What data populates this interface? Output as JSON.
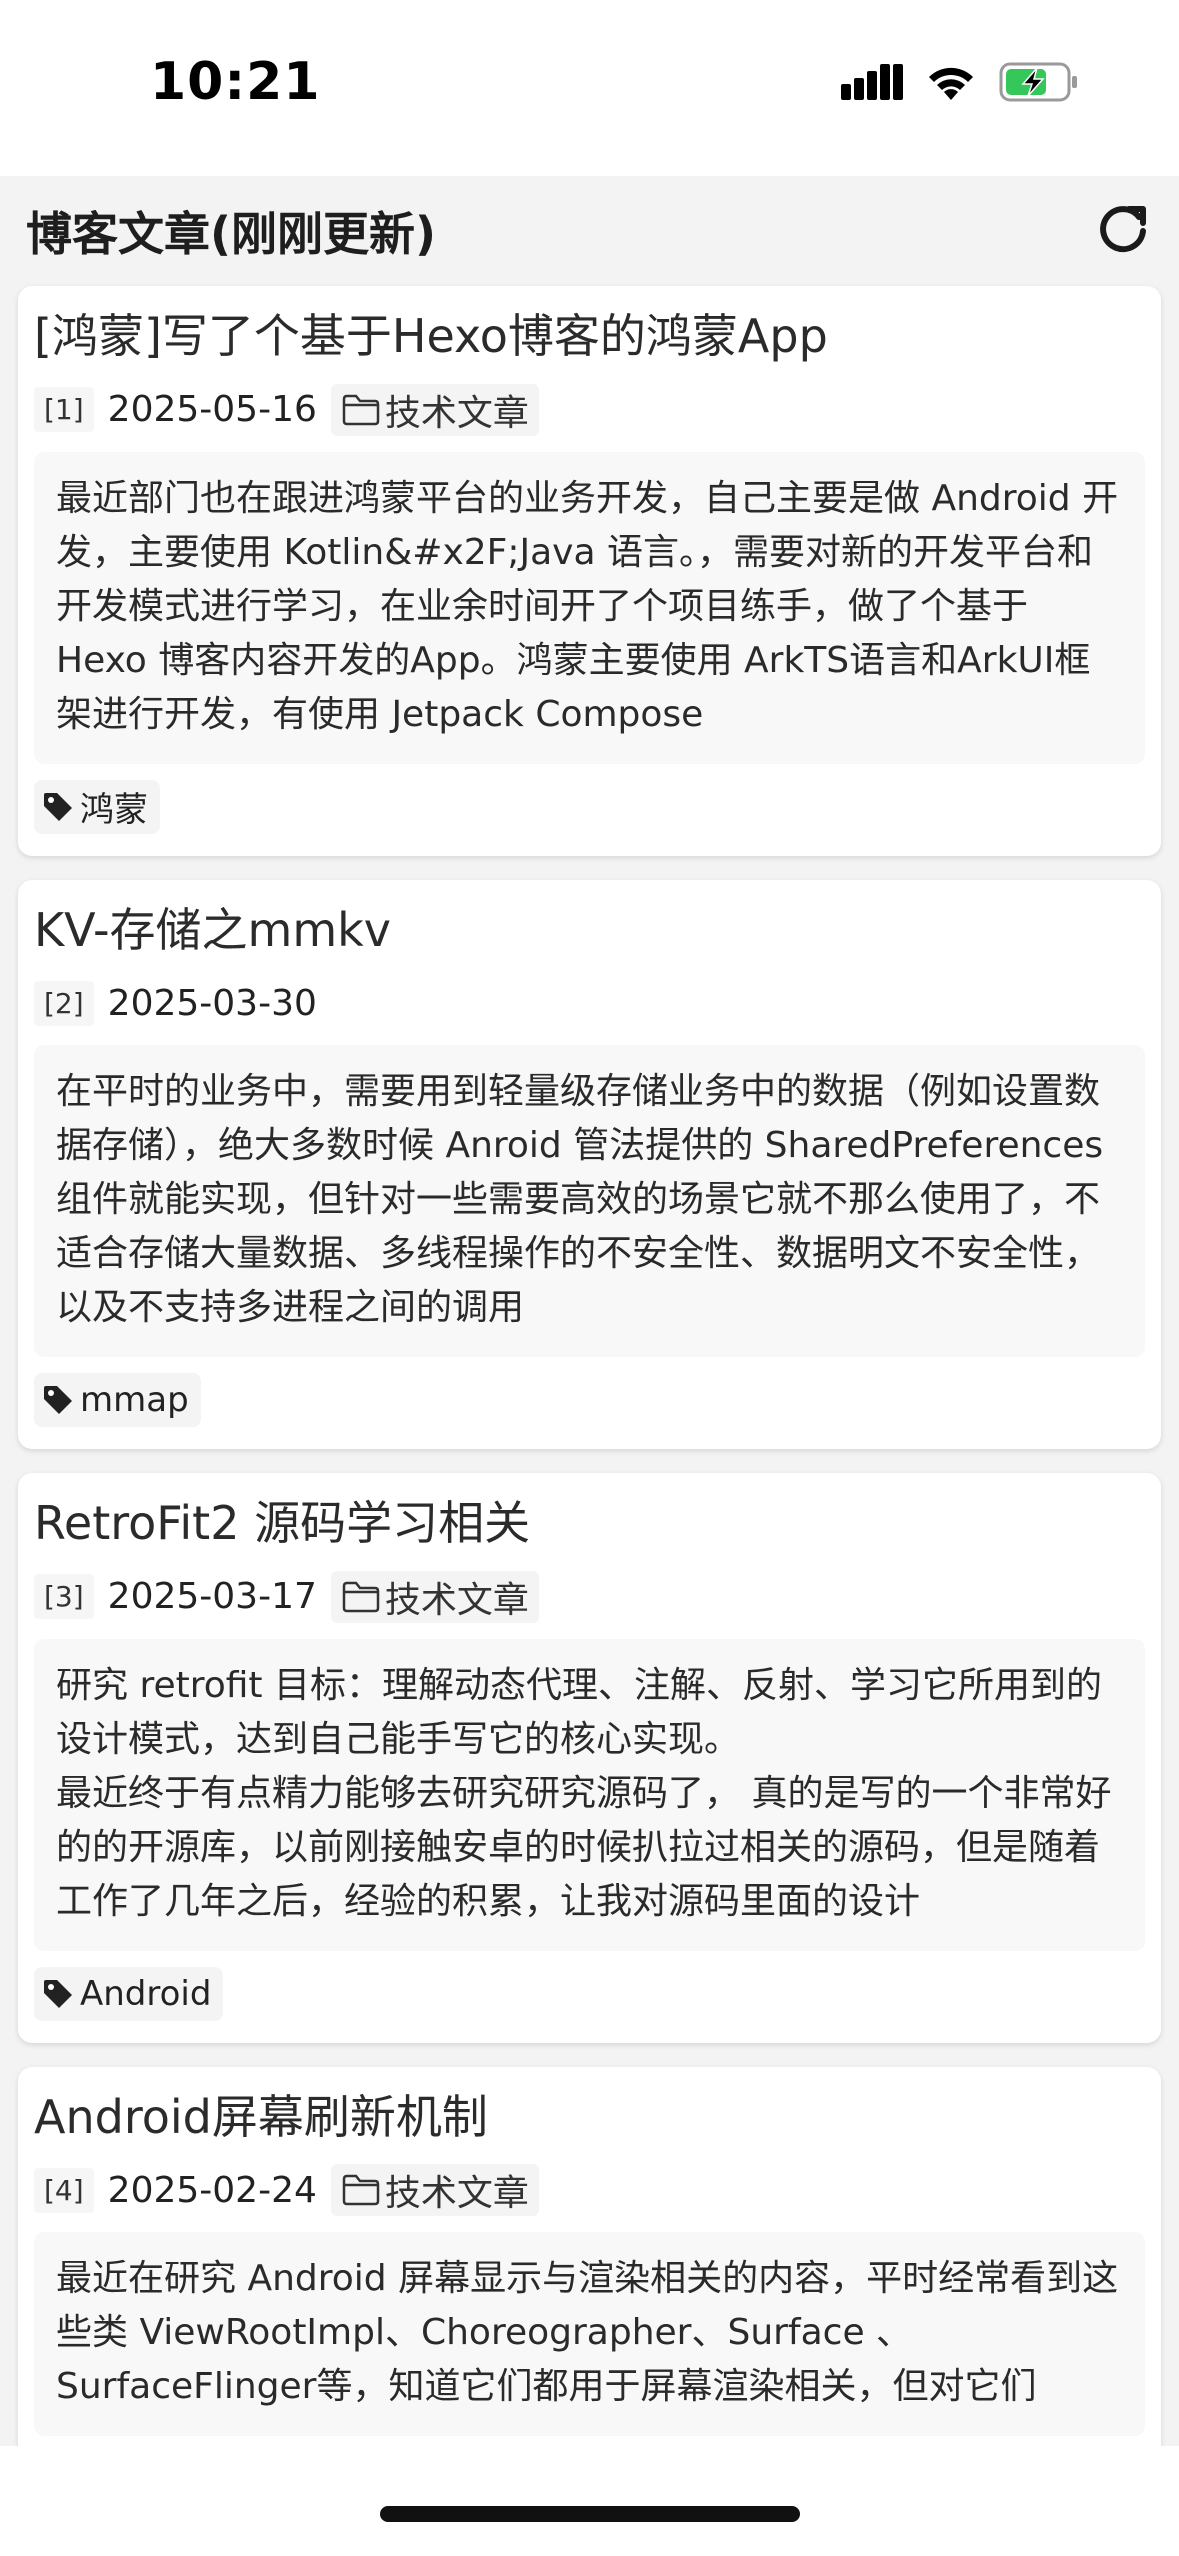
{
  "status_bar": {
    "time": "10:21"
  },
  "header": {
    "title": "博客文章(刚刚更新)",
    "refresh_icon": "refresh-icon"
  },
  "posts": [
    {
      "title": "[鸿蒙]写了个基于Hexo博客的鸿蒙App",
      "index": "[1]",
      "date": "2025-05-16",
      "category": "技术文章",
      "excerpt": "最近部门也在跟进鸿蒙平台的业务开发，自己主要是做 Android 开发，主要使用 Kotlin&#x2F;Java 语言。，需要对新的开发平台和开发模式进行学习，在业余时间开了个项目练手，做了个基于 Hexo 博客内容开发的App。鸿蒙主要使用 ArkTS语言和ArkUI框架进行开发，有使用 Jetpack Compose",
      "tag": "鸿蒙"
    },
    {
      "title": "KV-存储之mmkv",
      "index": "[2]",
      "date": "2025-03-30",
      "category": "",
      "excerpt": "在平时的业务中，需要用到轻量级存储业务中的数据（例如设置数据存储），绝大多数时候 Anroid 管法提供的 SharedPreferences  组件就能实现，但针对一些需要高效的场景它就不那么使用了，不适合存储大量数据、多线程操作的不安全性、数据明文不安全性，以及不支持多进程之间的调用",
      "tag": "mmap"
    },
    {
      "title": "RetroFit2 源码学习相关",
      "index": "[3]",
      "date": "2025-03-17",
      "category": "技术文章",
      "excerpt": "研究 retrofit 目标：理解动态代理、注解、反射、学习它所用到的设计模式，达到自己能手写它的核心实现。\n最近终于有点精力能够去研究研究源码了， 真的是写的一个非常好的的开源库，以前刚接触安卓的时候扒拉过相关的源码，但是随着工作了几年之后，经验的积累，让我对源码里面的设计",
      "tag": "Android"
    },
    {
      "title": "Android屏幕刷新机制",
      "index": "[4]",
      "date": "2025-02-24",
      "category": "技术文章",
      "excerpt": "最近在研究 Android 屏幕显示与渲染相关的内容，平时经常看到这些类 ViewRootImpl、Choreographer、Surface 、SurfaceFlinger等，知道它们都用于屏幕渲染相关，但对它们",
      "tag": ""
    }
  ]
}
